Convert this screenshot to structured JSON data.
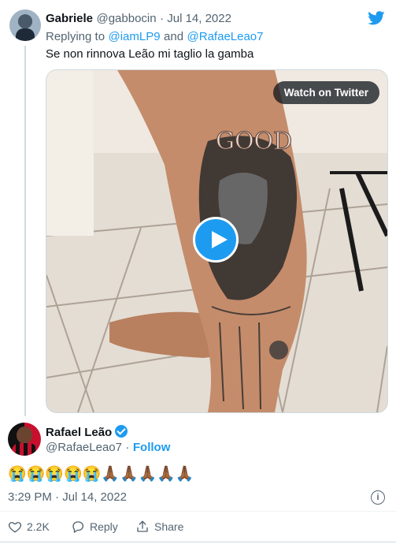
{
  "reply_tweet": {
    "author_name": "Gabriele",
    "author_handle": "@gabbocin",
    "date": "· Jul 14, 2022",
    "replying_prefix": "Replying to",
    "replying_to_1": "@iamLP9",
    "replying_and": "and",
    "replying_to_2": "@RafaeLeao7",
    "text": "Se non rinnova Leão mi taglio la gamba",
    "media": {
      "watch_label": "Watch on Twitter",
      "tattoo_text": "GOOD"
    }
  },
  "main_tweet": {
    "author_name": "Rafael Leão",
    "author_handle": "@RafaeLeao7",
    "separator": "·",
    "follow_label": "Follow",
    "text": "😭😭😭😭😭🙏🏾🙏🏾🙏🏾🙏🏾🙏🏾",
    "timestamp": "3:29 PM · Jul 14, 2022",
    "like_count": "2.2K",
    "reply_label": "Reply",
    "share_label": "Share"
  },
  "colors": {
    "accent": "#1d9bf0",
    "text_primary": "#0f1419",
    "text_secondary": "#536471"
  },
  "icons": [
    "twitter-bird-icon",
    "play-icon",
    "verified-badge-icon",
    "info-icon",
    "heart-icon",
    "reply-icon",
    "share-icon"
  ]
}
